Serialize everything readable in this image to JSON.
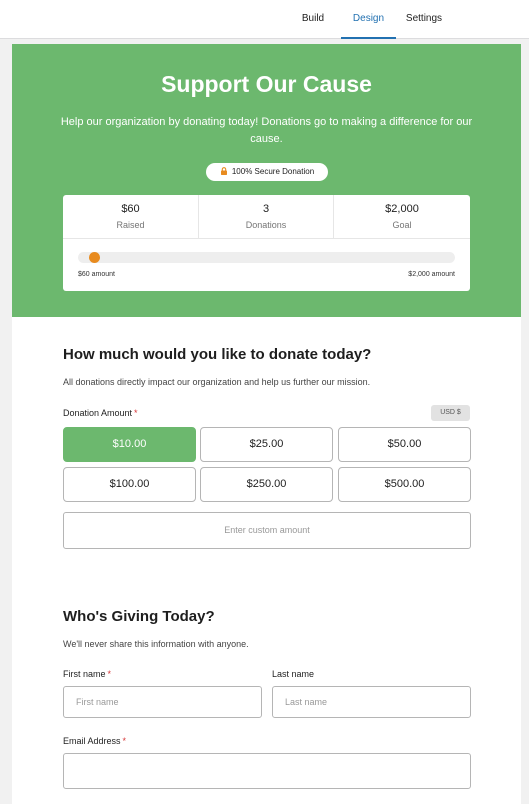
{
  "tabs": [
    {
      "label": "Build"
    },
    {
      "label": "Design"
    },
    {
      "label": "Settings"
    }
  ],
  "hero": {
    "title": "Support Our Cause",
    "subtitle": "Help our organization by donating today! Donations go to making a difference for our cause.",
    "secure_badge": "100% Secure Donation"
  },
  "stats": [
    {
      "value": "$60",
      "label": "Raised"
    },
    {
      "value": "3",
      "label": "Donations"
    },
    {
      "value": "$2,000",
      "label": "Goal"
    }
  ],
  "progress": {
    "fraction": 0.03,
    "start_label": "$60 amount",
    "end_label": "$2,000 amount"
  },
  "donate": {
    "heading": "How much would you like to donate today?",
    "description": "All donations directly impact our organization and help us further our mission.",
    "amount_label": "Donation Amount",
    "required_mark": "*",
    "currency": "USD  $",
    "options": [
      "$10.00",
      "$25.00",
      "$50.00",
      "$100.00",
      "$250.00",
      "$500.00"
    ],
    "selected": "$10.00",
    "custom_placeholder": "Enter custom amount"
  },
  "giver": {
    "heading": "Who's Giving Today?",
    "description": "We'll never share this information with anyone.",
    "first_name_label": "First name",
    "first_name_placeholder": "First name",
    "last_name_label": "Last name",
    "last_name_placeholder": "Last name",
    "email_label": "Email Address",
    "required_mark": "*"
  },
  "colors": {
    "accent_green": "#6cb86e",
    "progress_orange": "#e88b1f",
    "tab_active_blue": "#2271b1",
    "required_red": "#d63638"
  }
}
